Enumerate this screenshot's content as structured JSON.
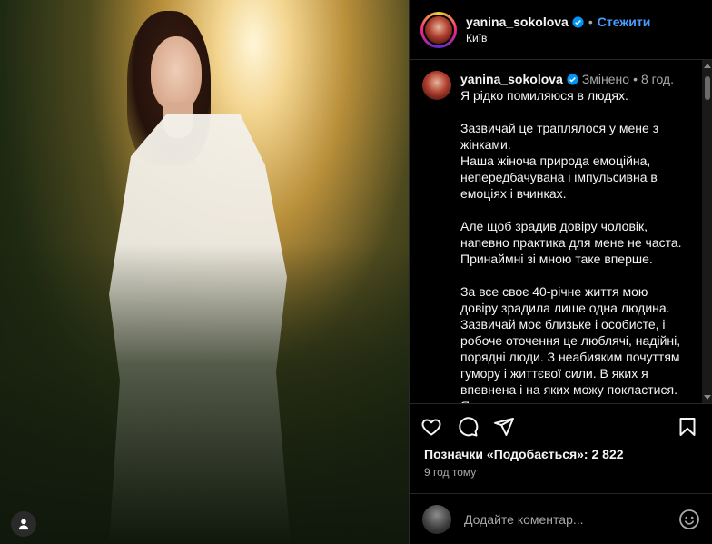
{
  "post": {
    "username": "yanina_sokolova",
    "follow_label": "Стежити",
    "separator": "•",
    "location": "Київ"
  },
  "caption": {
    "username": "yanina_sokolova",
    "edited": "Змінено",
    "separator": "•",
    "age": "8 год.",
    "paragraphs": [
      "Я рідко помиляюся в людях.",
      "Зазвичай це траплялося  у мене з жінками.\nНаша жіноча природа емоційна, непередбачувана і імпульсивна в емоціях і вчинках.",
      "Але щоб зрадив довіру чоловік, напевно практика для мене не часта. Принаймні зі мною таке вперше.",
      "За все своє 40-річне життя мою довіру зрадила лише одна людина. Зазвичай моє близьке і особисте, і робоче оточення це люблячі, надійні, порядні люди. З неабияким почуттям гумору і життєвої сили. В яких я впевнена і на яких можу покластися. Я ..."
    ]
  },
  "engagement": {
    "likes_text": "Позначки «Подобається»: 2 822",
    "time_ago": "9 год тому"
  },
  "comment": {
    "placeholder": "Додайте коментар..."
  },
  "icons": {
    "like": "heart-icon",
    "comment": "comment-icon",
    "share": "send-icon",
    "save": "bookmark-icon",
    "emoji": "emoji-icon",
    "verified": "verified-badge-icon"
  },
  "colors": {
    "accent": "#4a9eff",
    "background": "#000000",
    "text": "#f5f5f5",
    "muted": "#a8a8a8"
  }
}
